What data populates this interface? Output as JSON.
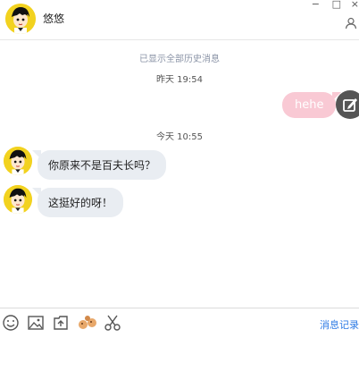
{
  "header": {
    "contact_name": "悠悠",
    "window_controls": [
      "−",
      "□",
      "×"
    ]
  },
  "chat": {
    "history_notice": "已显示全部历史消息",
    "messages": [
      {
        "type": "timestamp",
        "text": "昨天 19:54"
      },
      {
        "type": "sent",
        "text": "hehe"
      },
      {
        "type": "timestamp",
        "text": "今天 10:55"
      },
      {
        "type": "received",
        "text": "你原来不是百夫长吗？"
      },
      {
        "type": "received",
        "text": "这挺好的呀！"
      }
    ]
  },
  "toolbar": {
    "icons": [
      "emoji-icon",
      "image-icon",
      "upload-file-icon",
      "shake-icon",
      "scissors-icon"
    ],
    "history_label": "消息记录"
  },
  "colors": {
    "sent_bubble": "#f9c9d4",
    "received_bubble": "#e9edf2",
    "link": "#2d7be5",
    "avatar_bg": "#f2d21f"
  }
}
